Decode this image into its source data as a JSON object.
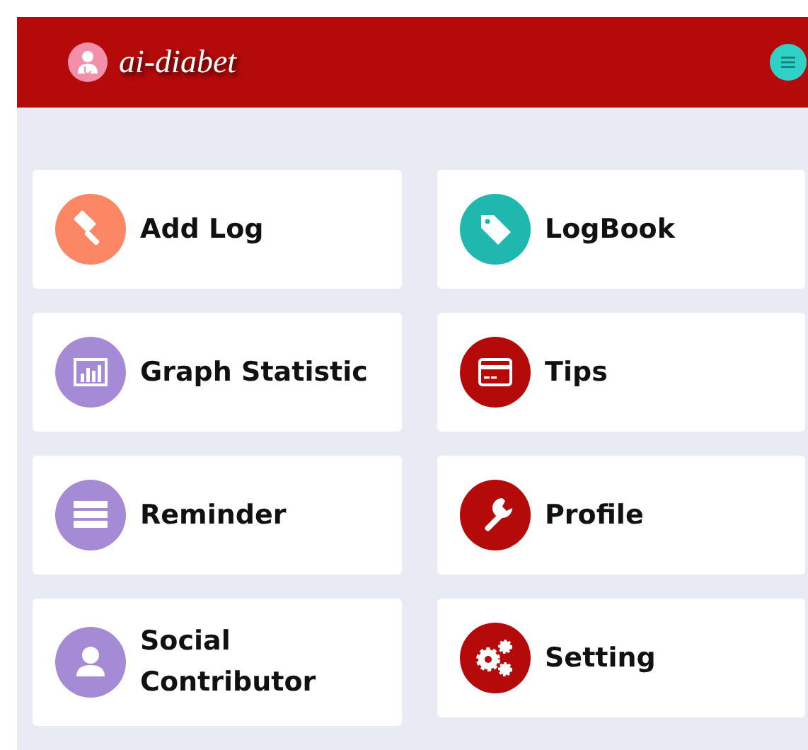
{
  "header": {
    "title": "ai-diabet"
  },
  "tiles": [
    {
      "label": "Add Log",
      "color": "#fc8765"
    },
    {
      "label": "LogBook",
      "color": "#20b7ae"
    },
    {
      "label": "Graph Statistic",
      "color": "#a58ad6"
    },
    {
      "label": "Tips",
      "color": "#b50a0a"
    },
    {
      "label": "Reminder",
      "color": "#a58ad6"
    },
    {
      "label": "Profile",
      "color": "#b50a0a"
    },
    {
      "label": "Social Contributor",
      "color": "#a58ad6"
    },
    {
      "label": "Setting",
      "color": "#b50a0a"
    }
  ]
}
